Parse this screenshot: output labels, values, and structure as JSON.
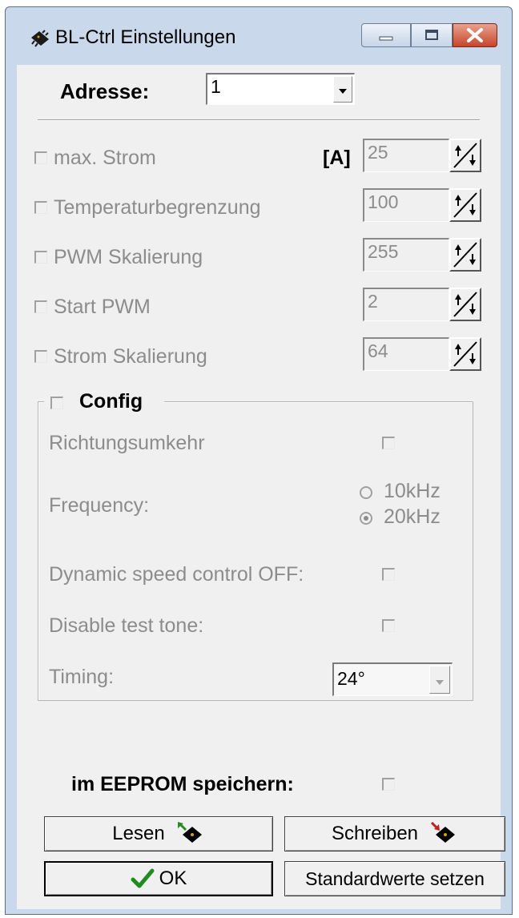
{
  "window": {
    "title": "BL-Ctrl Einstellungen"
  },
  "address": {
    "label": "Adresse:",
    "value": "1"
  },
  "settings": [
    {
      "label": "max. Strom",
      "unit": "[A]",
      "value": "25"
    },
    {
      "label": "Temperaturbegrenzung",
      "unit": "",
      "value": "100"
    },
    {
      "label": "PWM Skalierung",
      "unit": "",
      "value": "255"
    },
    {
      "label": "Start PWM",
      "unit": "",
      "value": "2"
    },
    {
      "label": "Strom Skalierung",
      "unit": "",
      "value": "64"
    }
  ],
  "config": {
    "label": "Config",
    "richtungsumkehr": "Richtungsumkehr",
    "frequency_label": "Frequency:",
    "freq_options": [
      "10kHz",
      "20kHz"
    ],
    "freq_selected": "20kHz",
    "dynamic_speed": "Dynamic speed control OFF:",
    "disable_tone": "Disable test tone:",
    "timing_label": "Timing:",
    "timing_value": "24°"
  },
  "eeprom": {
    "label": "im EEPROM speichern:"
  },
  "buttons": {
    "read": "Lesen",
    "write": "Schreiben",
    "ok": "OK",
    "defaults": "Standardwerte setzen"
  }
}
